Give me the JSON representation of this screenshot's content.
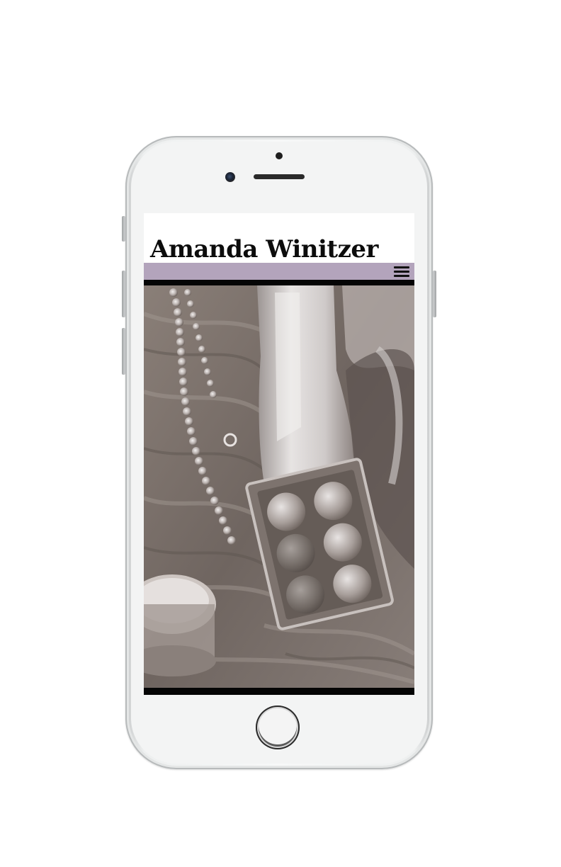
{
  "site": {
    "title": "Amanda Winitzer"
  },
  "nav": {
    "menu_icon": "hamburger-menu-icon",
    "bar_color": "#b3a4bc"
  },
  "hero": {
    "image_subject": "painting"
  },
  "device": {
    "frame_color": "#f3f4f4"
  }
}
